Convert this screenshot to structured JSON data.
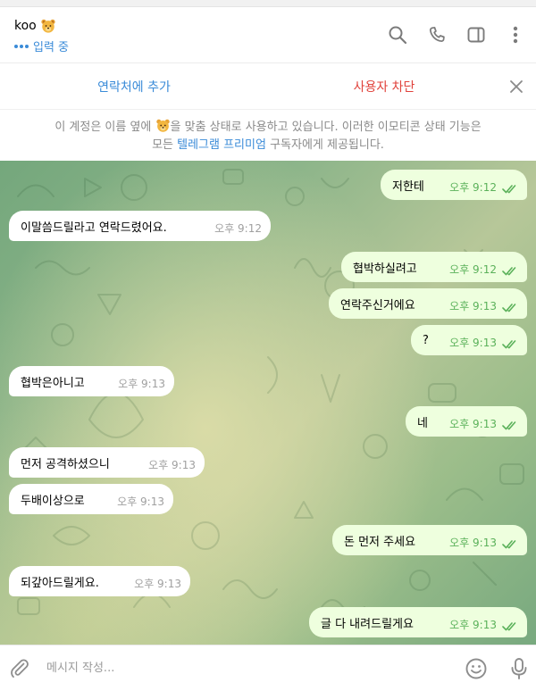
{
  "header": {
    "contact_name": "koo",
    "status_text": "입력 중"
  },
  "actionbar": {
    "add_contact_label": "연락처에 추가",
    "block_user_label": "사용자 차단"
  },
  "notice": {
    "line1_before": "이 계정은 이름 옆에 ",
    "line1_after": "을 맞춤 상태로 사용하고 있습니다. 이러한 이모티콘 상태 기능은",
    "line2_before": "모든 ",
    "line2_link": "텔레그램 프리미엄",
    "line2_after": " 구독자에게 제공됩니다."
  },
  "messages": [
    {
      "direction": "out",
      "text": "저한테",
      "time": "오후 9:12",
      "read": true
    },
    {
      "direction": "in",
      "text": "이말씀드릴라고 연락드렸어요.",
      "time": "오후 9:12"
    },
    {
      "direction": "out",
      "text": "협박하실려고",
      "time": "오후 9:12",
      "read": true
    },
    {
      "direction": "out",
      "text": "연락주신거에요",
      "time": "오후 9:13",
      "read": true
    },
    {
      "direction": "out",
      "text": "?",
      "time": "오후 9:13",
      "read": true
    },
    {
      "direction": "in",
      "text": "협박은아니고",
      "time": "오후 9:13"
    },
    {
      "direction": "out",
      "text": "네",
      "time": "오후 9:13",
      "read": true
    },
    {
      "direction": "in",
      "text": "먼저 공격하셨으니",
      "time": "오후 9:13"
    },
    {
      "direction": "in",
      "text": "두배이상으로",
      "time": "오후 9:13"
    },
    {
      "direction": "out",
      "text": "돈 먼저 주세요",
      "time": "오후 9:13",
      "read": true
    },
    {
      "direction": "in",
      "text": "되갚아드릴게요.",
      "time": "오후 9:13"
    },
    {
      "direction": "out",
      "text": "글 다 내려드릴게요",
      "time": "오후 9:13",
      "read": true
    }
  ],
  "composer": {
    "placeholder": "메시지 작성..."
  },
  "icons": {
    "header": [
      "search-icon",
      "phone-icon",
      "sidebar-toggle-icon",
      "more-vertical-icon"
    ],
    "actionbar": [
      "close-icon"
    ],
    "composer": [
      "attach-icon",
      "emoji-icon",
      "microphone-icon"
    ],
    "status_emoji": "bear-emoji-icon",
    "read_receipt": "double-check-icon"
  },
  "colors": {
    "accent_blue": "#3a8bd8",
    "danger_red": "#e0423b",
    "outgoing_bubble": "#eeffde",
    "incoming_bubble": "#ffffff",
    "read_check": "#5bb15a",
    "wallpaper_green": "#8db58a"
  }
}
